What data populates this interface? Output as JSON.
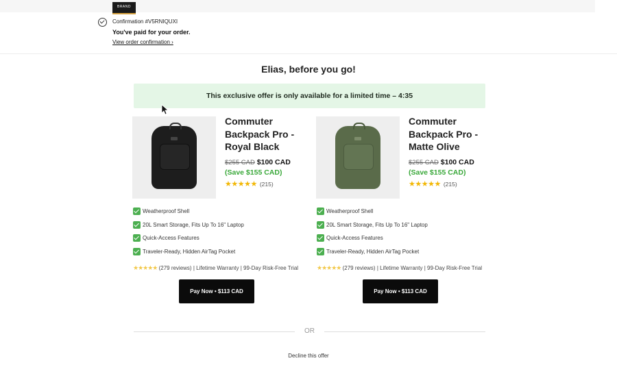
{
  "header": {
    "logo_text": "BRAND",
    "confirmation": "Confirmation #V5RNIQUXI",
    "paid_message": "You've paid for your order.",
    "view_link": "View order confirmation ›"
  },
  "main": {
    "heading": "Elias, before you go!",
    "offer_banner": "This exclusive offer is only available for a limited time – 4:35",
    "products": [
      {
        "title": "Commuter Backpack Pro - Royal Black",
        "old_price": "$255 CAD",
        "new_price": "$100 CAD",
        "savings": "(Save $155 CAD)",
        "stars": "★★★★★",
        "rating_count": "(215)",
        "image_icon": "black-backpack",
        "features": [
          "Weatherproof Shell",
          "20L Smart Storage, Fits Up To 16\" Laptop",
          "Quick-Access Features",
          "Traveler-Ready, Hidden AirTag Pocket"
        ],
        "review_stars": "★★★★★",
        "reviews_text": "(279 reviews) | Lifetime Warranty | 99-Day Risk-Free Trial",
        "pay_button": "Pay Now • $113 CAD"
      },
      {
        "title": "Commuter Backpack Pro - Matte Olive",
        "old_price": "$255 CAD",
        "new_price": "$100 CAD",
        "savings": "(Save $155 CAD)",
        "stars": "★★★★★",
        "rating_count": "(215)",
        "image_icon": "olive-backpack",
        "features": [
          "Weatherproof Shell",
          "20L Smart Storage, Fits Up To 16\" Laptop",
          "Quick-Access Features",
          "Traveler-Ready, Hidden AirTag Pocket"
        ],
        "review_stars": "★★★★★",
        "reviews_text": "(279 reviews) | Lifetime Warranty | 99-Day Risk-Free Trial",
        "pay_button": "Pay Now • $113 CAD"
      }
    ],
    "or_divider": "OR",
    "decline_link": "Decline this offer"
  },
  "colors": {
    "banner_bg": "#e4f6e6",
    "save_green": "#3aa83a",
    "check_green": "#4caf50",
    "star_gold": "#f2b705",
    "button_bg": "#0b0b0b"
  }
}
